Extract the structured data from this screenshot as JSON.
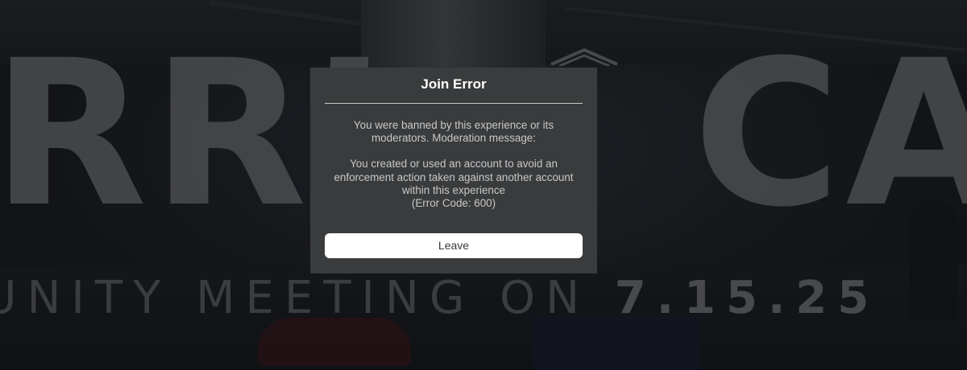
{
  "background": {
    "sign_left_letters": "RRI",
    "sign_right_letters": "CA",
    "banner_prefix": "IUNITY MEETING ON ",
    "banner_date": "7.15.25"
  },
  "dialog": {
    "title": "Join Error",
    "message_line_1": "You were banned by this experience or its",
    "message_line_2": "moderators. Moderation message:",
    "moderation_line_1": "You created or used an account to avoid an",
    "moderation_line_2": "enforcement action taken against another account",
    "moderation_line_3": "within this experience",
    "error_code": "(Error Code: 600)",
    "leave_label": "Leave"
  },
  "colors": {
    "dialog_bg": "#393b3d",
    "title_text": "#ffffff",
    "body_text": "#c8c8c8",
    "button_bg": "#ffffff",
    "button_text": "#393b3d"
  }
}
